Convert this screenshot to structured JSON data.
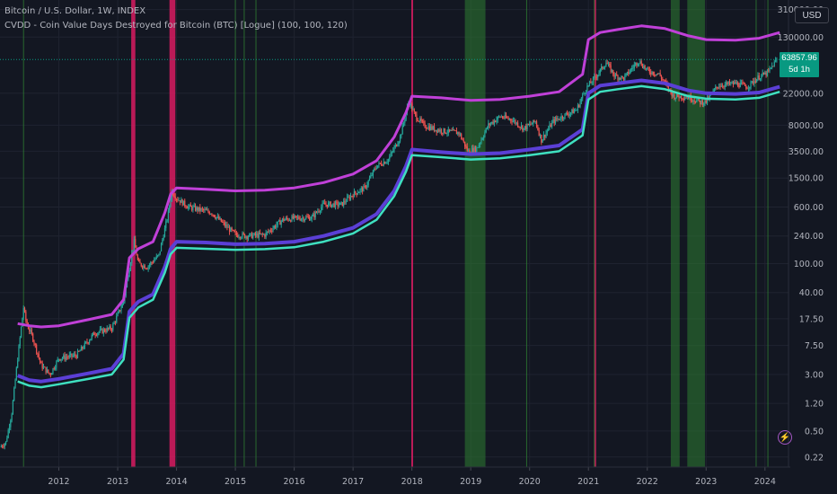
{
  "header": {
    "symbol": "Bitcoin / U.S. Dollar, 1W, INDEX",
    "indicator": "CVDD - Coin Value Days Destroyed for Bitcoin (BTC) [Logue] (100, 100, 120)"
  },
  "currency_button": "USD",
  "price_badge": {
    "price": "63857.96",
    "countdown": "5d 1h"
  },
  "alert_icon": "lightning-bolt-icon",
  "colors": {
    "background": "#131722",
    "upper_band": "#c040d8",
    "mid_band": "#5b3fd6",
    "lower_band": "#3fe0c0",
    "red_zone": "#d81b60",
    "green_zone": "#2e7d32",
    "candle_up": "#26a69a",
    "candle_down": "#ef5350",
    "price_badge": "#089981"
  },
  "chart_data": {
    "type": "line",
    "scale": "log",
    "x_unit": "year",
    "xlim": [
      2011.0,
      2024.4
    ],
    "ylim": [
      0.16,
      420000
    ],
    "x_ticks": [
      "2012",
      "2013",
      "2014",
      "2015",
      "2016",
      "2017",
      "2018",
      "2019",
      "2020",
      "2021",
      "2022",
      "2023",
      "2024"
    ],
    "y_ticks": [
      "310000.00",
      "130000.00",
      "22000.00",
      "8000.00",
      "3500.00",
      "1500.00",
      "600.00",
      "240.00",
      "100.00",
      "40.00",
      "17.50",
      "7.50",
      "3.00",
      "1.20",
      "0.50",
      "0.22"
    ],
    "current_price": 63857.96,
    "grid": true,
    "shaded_zones": {
      "red": [
        [
          2013.23,
          2013.3
        ],
        [
          2013.88,
          2013.98
        ],
        [
          2017.99,
          2018.02
        ],
        [
          2021.1,
          2021.12
        ]
      ],
      "green": [
        [
          2018.9,
          2019.25
        ],
        [
          2022.4,
          2022.55
        ],
        [
          2022.68,
          2022.98
        ]
      ],
      "green_lines": [
        2011.4,
        2015.0,
        2015.15,
        2015.35,
        2019.95,
        2021.1,
        2023.85,
        2024.05
      ]
    },
    "series": [
      {
        "key": "upper",
        "x": [
          2011.3,
          2011.5,
          2011.7,
          2012.0,
          2012.5,
          2012.9,
          2013.1,
          2013.2,
          2013.35,
          2013.6,
          2013.8,
          2013.9,
          2014.0,
          2014.5,
          2015.0,
          2015.5,
          2016.0,
          2016.5,
          2017.0,
          2017.4,
          2017.7,
          2017.9,
          2018.0,
          2018.5,
          2019.0,
          2019.5,
          2020.0,
          2020.5,
          2020.9,
          2021.0,
          2021.2,
          2021.5,
          2021.9,
          2022.3,
          2022.7,
          2023.0,
          2023.5,
          2023.9,
          2024.25
        ],
        "y": [
          15,
          14,
          13.5,
          14,
          17,
          20,
          32,
          120,
          160,
          200,
          500,
          900,
          1100,
          1050,
          1000,
          1020,
          1100,
          1300,
          1700,
          2600,
          5500,
          12000,
          20000,
          19000,
          17500,
          18000,
          20000,
          23000,
          40000,
          120000,
          150000,
          165000,
          185000,
          170000,
          135000,
          120000,
          118000,
          125000,
          150000
        ]
      },
      {
        "key": "mid",
        "x": [
          2011.3,
          2011.5,
          2011.7,
          2012.0,
          2012.5,
          2012.9,
          2013.1,
          2013.2,
          2013.35,
          2013.6,
          2013.8,
          2013.9,
          2014.0,
          2014.5,
          2015.0,
          2015.5,
          2016.0,
          2016.5,
          2017.0,
          2017.4,
          2017.7,
          2017.9,
          2018.0,
          2018.5,
          2019.0,
          2019.5,
          2020.0,
          2020.5,
          2020.9,
          2021.0,
          2021.2,
          2021.5,
          2021.9,
          2022.3,
          2022.7,
          2023.0,
          2023.5,
          2023.9,
          2024.25
        ],
        "y": [
          2.9,
          2.5,
          2.4,
          2.6,
          3.1,
          3.6,
          5.8,
          22,
          30,
          38,
          90,
          160,
          200,
          195,
          185,
          188,
          200,
          240,
          310,
          480,
          1000,
          2200,
          3700,
          3400,
          3200,
          3300,
          3700,
          4200,
          7000,
          22000,
          28000,
          30000,
          33000,
          30000,
          24000,
          22000,
          21500,
          22500,
          27000
        ]
      },
      {
        "key": "lower",
        "x": [
          2011.3,
          2011.5,
          2011.7,
          2012.0,
          2012.5,
          2012.9,
          2013.1,
          2013.2,
          2013.35,
          2013.6,
          2013.8,
          2013.9,
          2014.0,
          2014.5,
          2015.0,
          2015.5,
          2016.0,
          2016.5,
          2017.0,
          2017.4,
          2017.7,
          2017.9,
          2018.0,
          2018.5,
          2019.0,
          2019.5,
          2020.0,
          2020.5,
          2020.9,
          2021.0,
          2021.2,
          2021.5,
          2021.9,
          2022.3,
          2022.7,
          2023.0,
          2023.5,
          2023.9,
          2024.25
        ],
        "y": [
          2.4,
          2.1,
          2.0,
          2.2,
          2.6,
          3.0,
          4.8,
          18,
          25,
          32,
          75,
          135,
          165,
          160,
          155,
          158,
          168,
          200,
          260,
          400,
          850,
          1850,
          3100,
          2900,
          2700,
          2800,
          3100,
          3500,
          5800,
          18000,
          23000,
          25000,
          27500,
          25000,
          20000,
          18500,
          18000,
          19000,
          23000
        ]
      },
      {
        "key": "price",
        "x": [
          2011.0,
          2011.1,
          2011.2,
          2011.3,
          2011.4,
          2011.45,
          2011.55,
          2011.7,
          2011.85,
          2012.0,
          2012.3,
          2012.6,
          2012.9,
          2013.1,
          2013.2,
          2013.28,
          2013.35,
          2013.5,
          2013.7,
          2013.85,
          2013.92,
          2014.0,
          2014.2,
          2014.4,
          2014.6,
          2014.8,
          2015.0,
          2015.2,
          2015.5,
          2015.8,
          2016.0,
          2016.3,
          2016.5,
          2016.8,
          2017.0,
          2017.2,
          2017.4,
          2017.6,
          2017.8,
          2017.95,
          2018.05,
          2018.2,
          2018.4,
          2018.6,
          2018.8,
          2018.95,
          2019.1,
          2019.3,
          2019.5,
          2019.7,
          2019.9,
          2020.1,
          2020.2,
          2020.4,
          2020.6,
          2020.8,
          2020.95,
          2021.1,
          2021.3,
          2021.45,
          2021.6,
          2021.85,
          2022.0,
          2022.2,
          2022.45,
          2022.7,
          2022.9,
          2023.0,
          2023.2,
          2023.5,
          2023.7,
          2023.9,
          2024.05,
          2024.2
        ],
        "y": [
          0.3,
          0.35,
          0.9,
          5,
          25,
          15,
          10,
          4,
          3,
          5,
          5.5,
          11,
          13,
          30,
          90,
          200,
          100,
          90,
          130,
          450,
          1000,
          800,
          600,
          550,
          500,
          350,
          250,
          240,
          250,
          400,
          420,
          430,
          650,
          650,
          900,
          1100,
          2200,
          2700,
          5500,
          17000,
          11000,
          8000,
          7000,
          6500,
          6300,
          3500,
          3800,
          8000,
          10500,
          9500,
          7200,
          9000,
          5000,
          9000,
          11000,
          13000,
          25000,
          35000,
          58000,
          38000,
          35000,
          62000,
          45000,
          40000,
          20000,
          19500,
          16500,
          16800,
          28000,
          30000,
          27000,
          37000,
          42000,
          63858
        ]
      }
    ]
  }
}
